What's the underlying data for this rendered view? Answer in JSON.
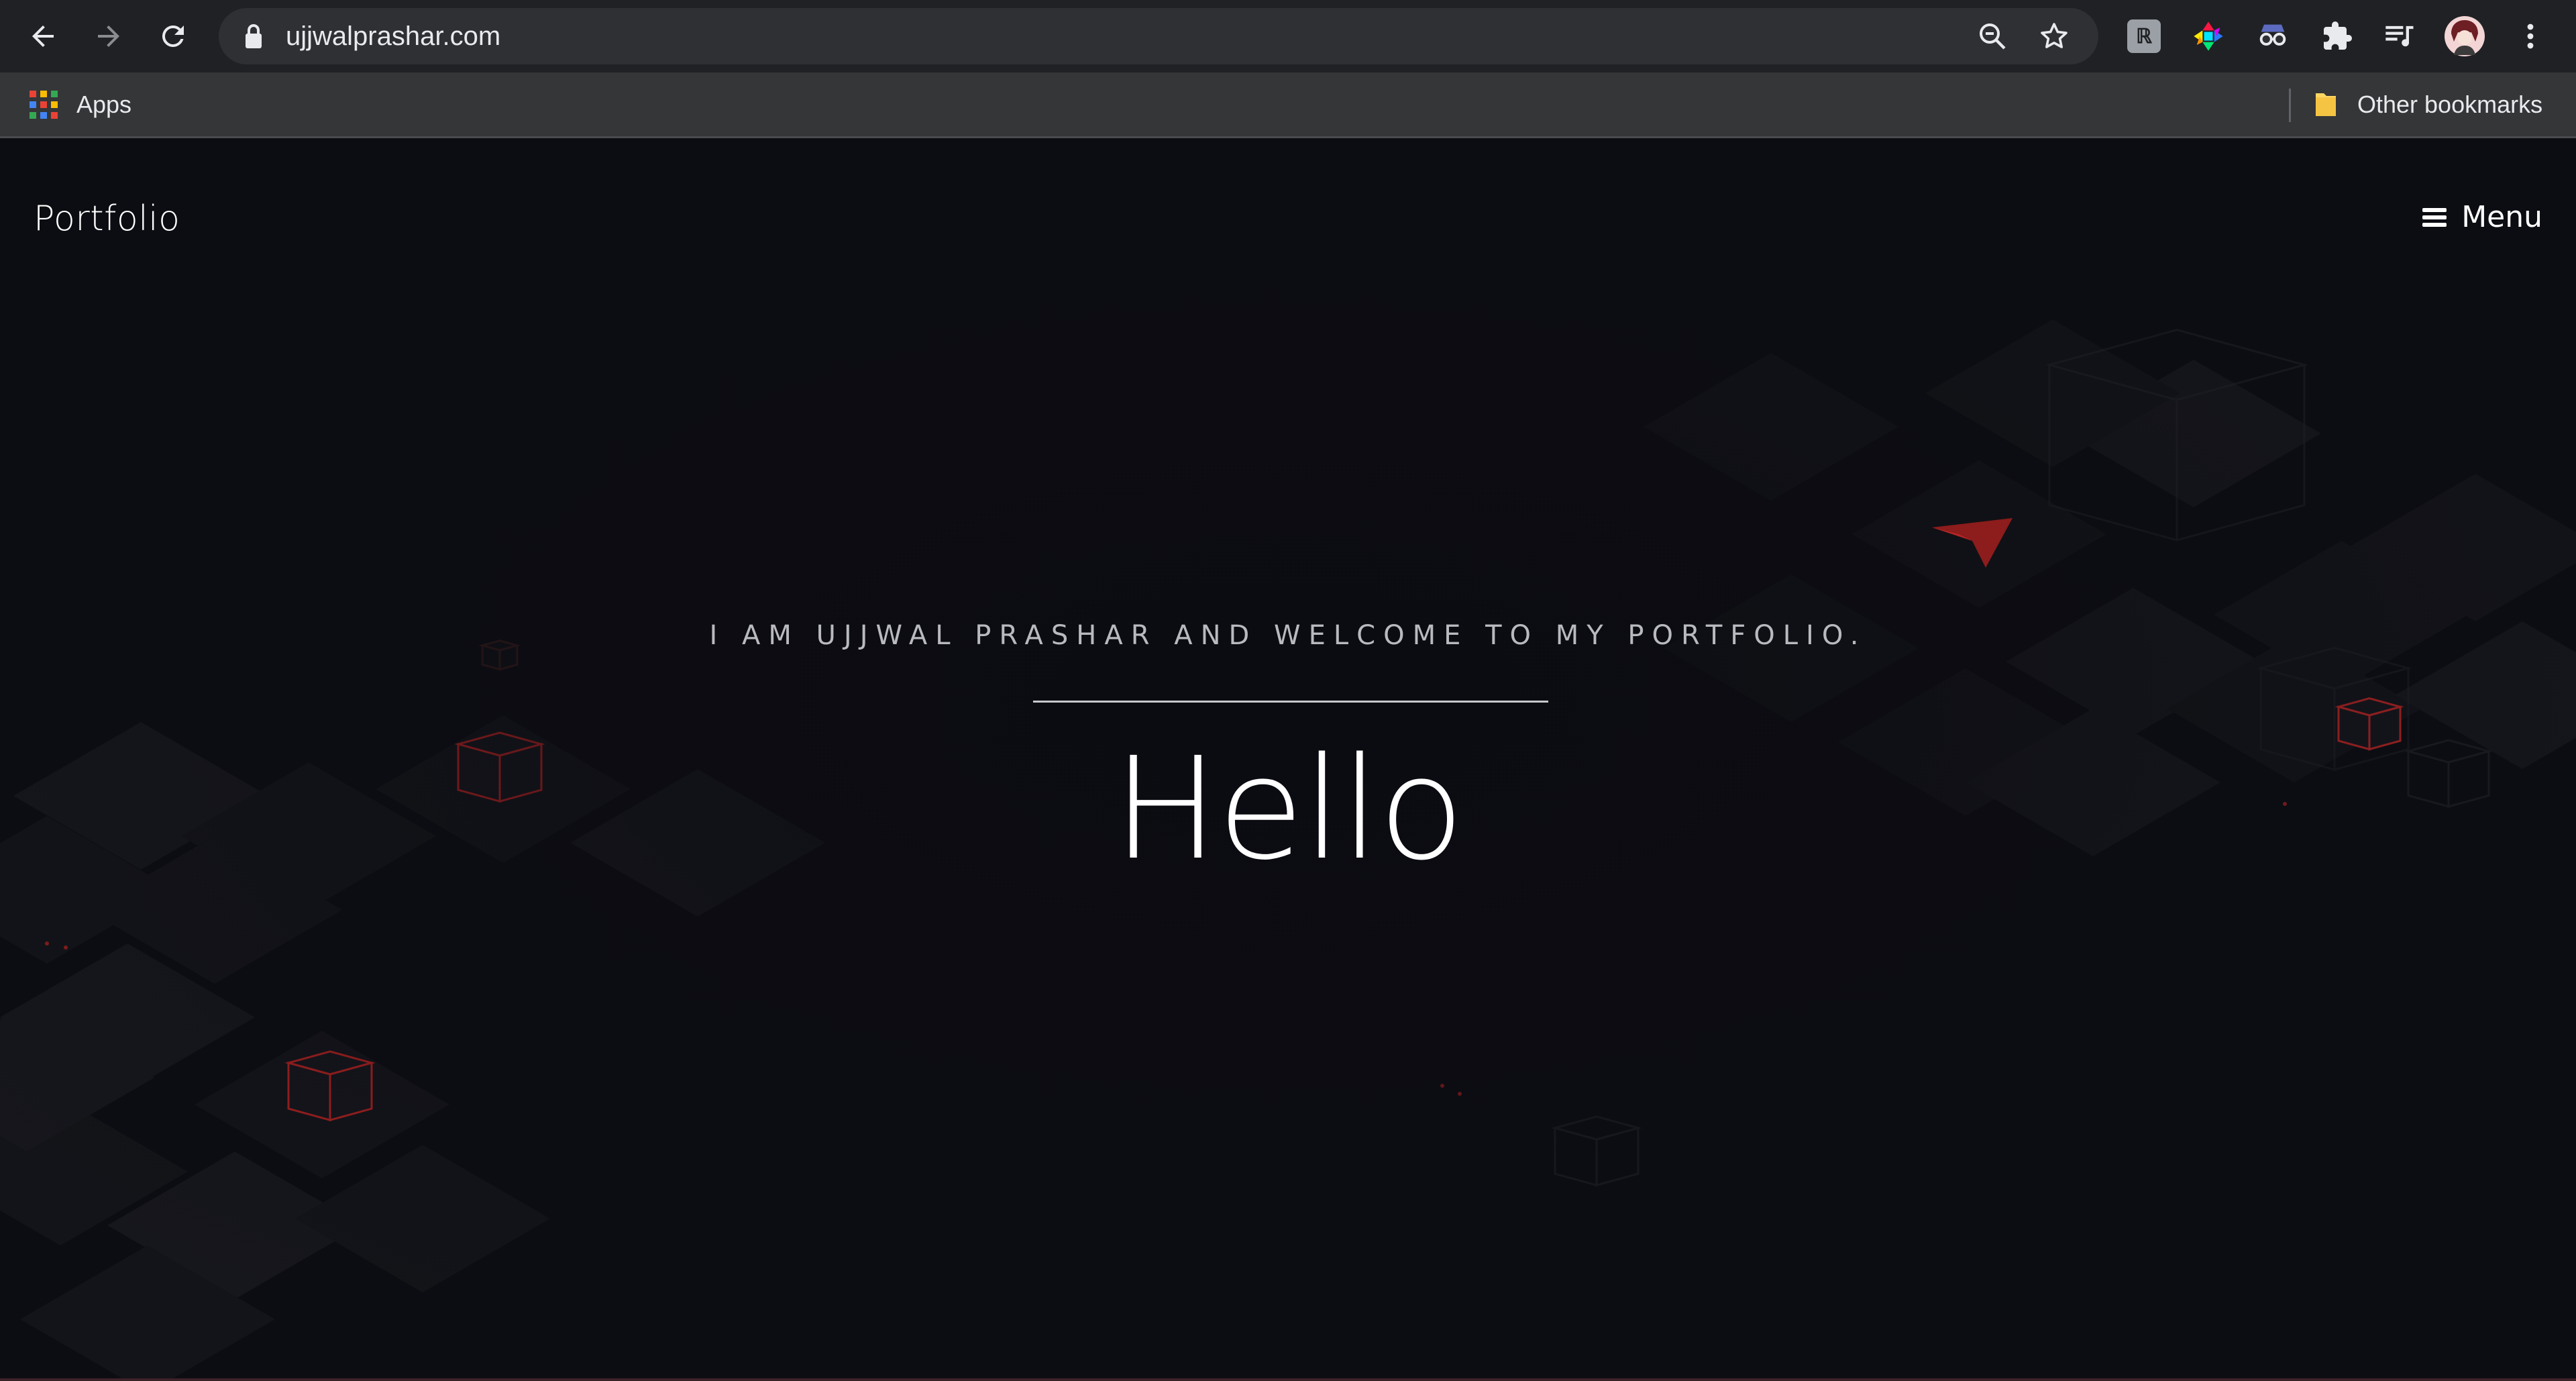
{
  "browser": {
    "url": "ujjwalprashar.com",
    "bookmarks": {
      "apps_label": "Apps",
      "other_label": "Other bookmarks"
    },
    "extensions": [
      "extension-icon-gray",
      "color-picker-extension-icon",
      "spy-extension-icon",
      "extensions-puzzle-icon",
      "media-playlist-icon"
    ]
  },
  "page": {
    "brand": "Portfolio",
    "menu_label": "Menu",
    "tagline": "I AM UJJWAL PRASHAR AND WELCOME TO MY PORTFOLIO.",
    "headline": "Hello"
  },
  "colors": {
    "background": "#0c0d12",
    "accent_red": "#c62828",
    "chrome_toolbar": "#202124",
    "bookmarks_bar": "#353638"
  }
}
